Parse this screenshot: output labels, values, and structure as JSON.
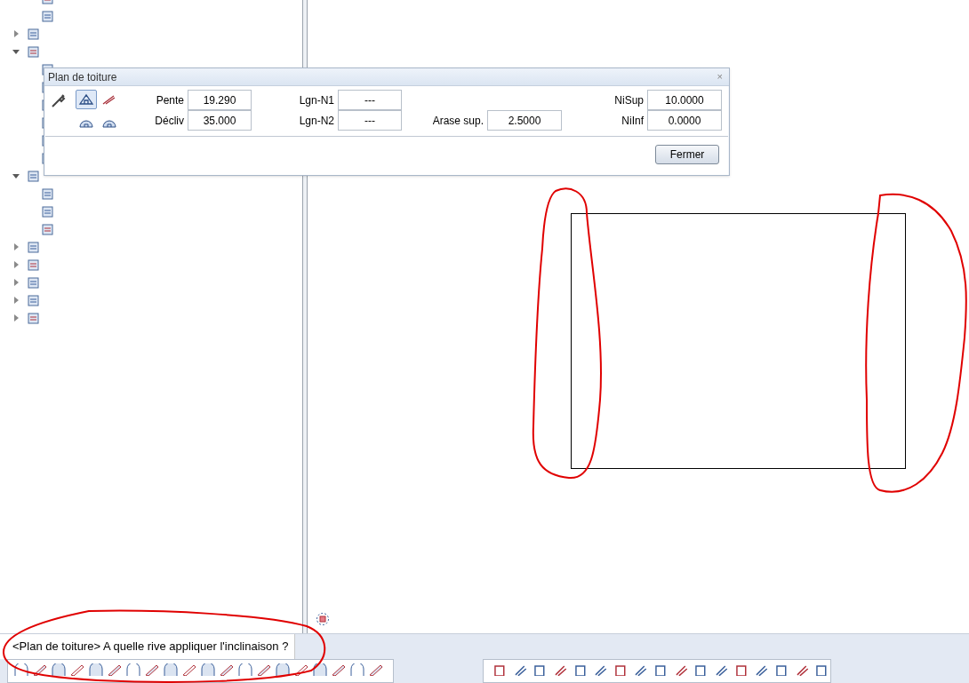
{
  "tree": [
    {
      "kind": "leaf"
    },
    {
      "kind": "leaf"
    },
    {
      "kind": "branch",
      "expanded": false
    },
    {
      "kind": "branch",
      "expanded": true,
      "children": [
        {
          "kind": "leaf"
        },
        {
          "kind": "leaf"
        },
        {
          "kind": "leaf"
        },
        {
          "kind": "leaf"
        },
        {
          "kind": "leaf"
        },
        {
          "kind": "leaf"
        }
      ]
    },
    {
      "kind": "branch",
      "expanded": true,
      "children": [
        {
          "kind": "leaf"
        },
        {
          "kind": "leaf"
        },
        {
          "kind": "leaf"
        }
      ]
    },
    {
      "kind": "branch",
      "expanded": false
    },
    {
      "kind": "branch",
      "expanded": false
    },
    {
      "kind": "branch",
      "expanded": false
    },
    {
      "kind": "branch",
      "expanded": false
    },
    {
      "kind": "branch",
      "expanded": false
    }
  ],
  "dialog": {
    "title": "Plan de toiture",
    "close": "×",
    "tool_buttons": [
      {
        "selected": true
      },
      {
        "selected": false
      },
      {
        "selected": false
      },
      {
        "selected": false
      }
    ],
    "columns": [
      {
        "fields": [
          {
            "label": "Pente",
            "value": "19.290"
          },
          {
            "label": "Décliv",
            "value": "35.000"
          }
        ]
      },
      {
        "fields": [
          {
            "label": "Lgn-N1",
            "value": "---"
          },
          {
            "label": "Lgn-N2",
            "value": "---"
          }
        ]
      },
      {
        "fields": [
          {
            "label": "Arase sup.",
            "value": "2.5000"
          }
        ]
      },
      {
        "fields": [
          {
            "label": "NiSup",
            "value": "10.0000"
          },
          {
            "label": "NiInf",
            "value": "0.0000"
          }
        ]
      }
    ],
    "button": "Fermer"
  },
  "prompt": "<Plan de toiture> A quelle rive appliquer l'inclinaison ?"
}
